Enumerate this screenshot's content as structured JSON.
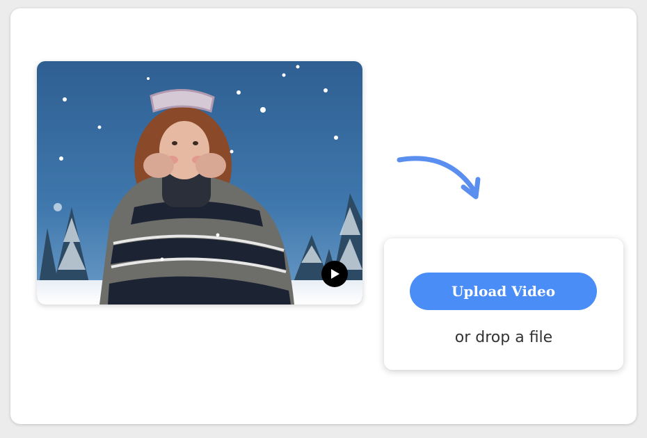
{
  "upload_card": {
    "button_label": "Upload Video",
    "drop_text": "or drop a file"
  },
  "video": {
    "icon": "play-icon"
  },
  "decoration": {
    "arrow_icon": "curved-arrow-icon"
  },
  "colors": {
    "accent": "#4a8df7",
    "arrow": "#5a8fef",
    "card_background": "#ffffff",
    "page_background": "#ececec"
  }
}
